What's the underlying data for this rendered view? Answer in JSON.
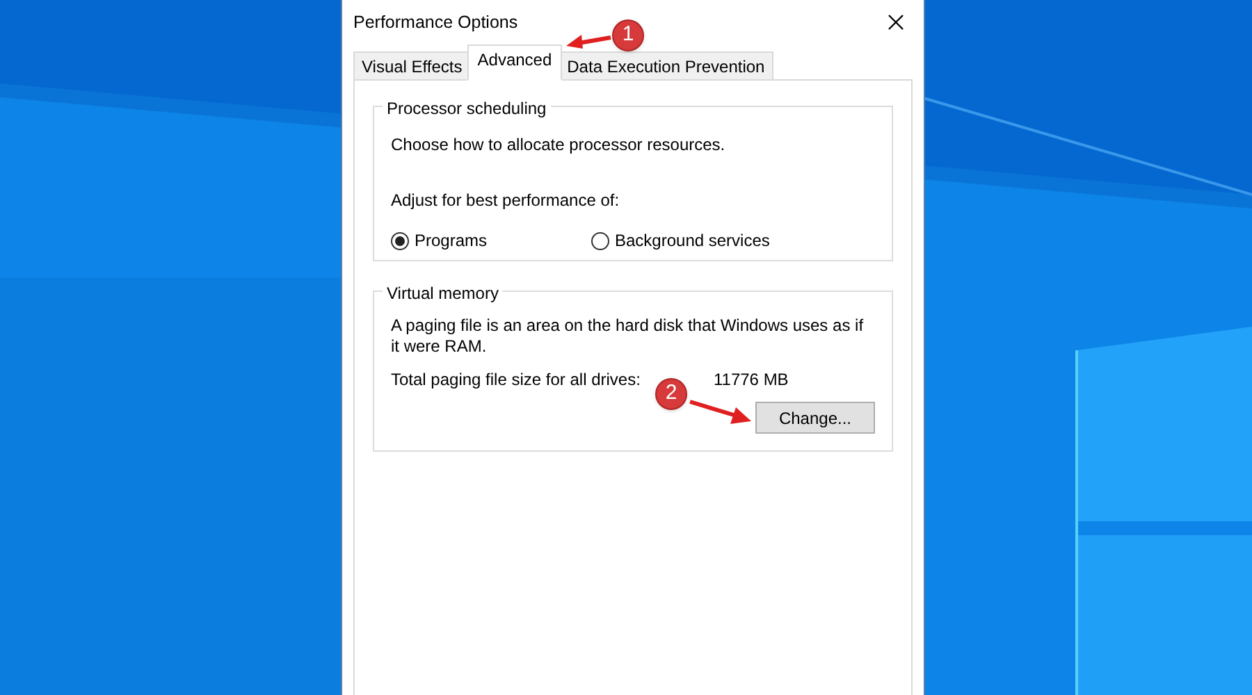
{
  "window": {
    "title": "Performance Options"
  },
  "tabs": [
    {
      "label": "Visual Effects",
      "selected": false
    },
    {
      "label": "Advanced",
      "selected": true
    },
    {
      "label": "Data Execution Prevention",
      "selected": false
    }
  ],
  "processor_scheduling": {
    "title": "Processor scheduling",
    "description": "Choose how to allocate processor resources.",
    "prompt": "Adjust for best performance of:",
    "options": [
      {
        "label": "Programs",
        "selected": true
      },
      {
        "label": "Background services",
        "selected": false
      }
    ]
  },
  "virtual_memory": {
    "title": "Virtual memory",
    "description": "A paging file is an area on the hard disk that Windows uses as if it were RAM.",
    "total_label": "Total paging file size for all drives:",
    "total_value": "11776 MB",
    "button": "Change..."
  },
  "annotations": [
    {
      "number": "1"
    },
    {
      "number": "2"
    }
  ]
}
